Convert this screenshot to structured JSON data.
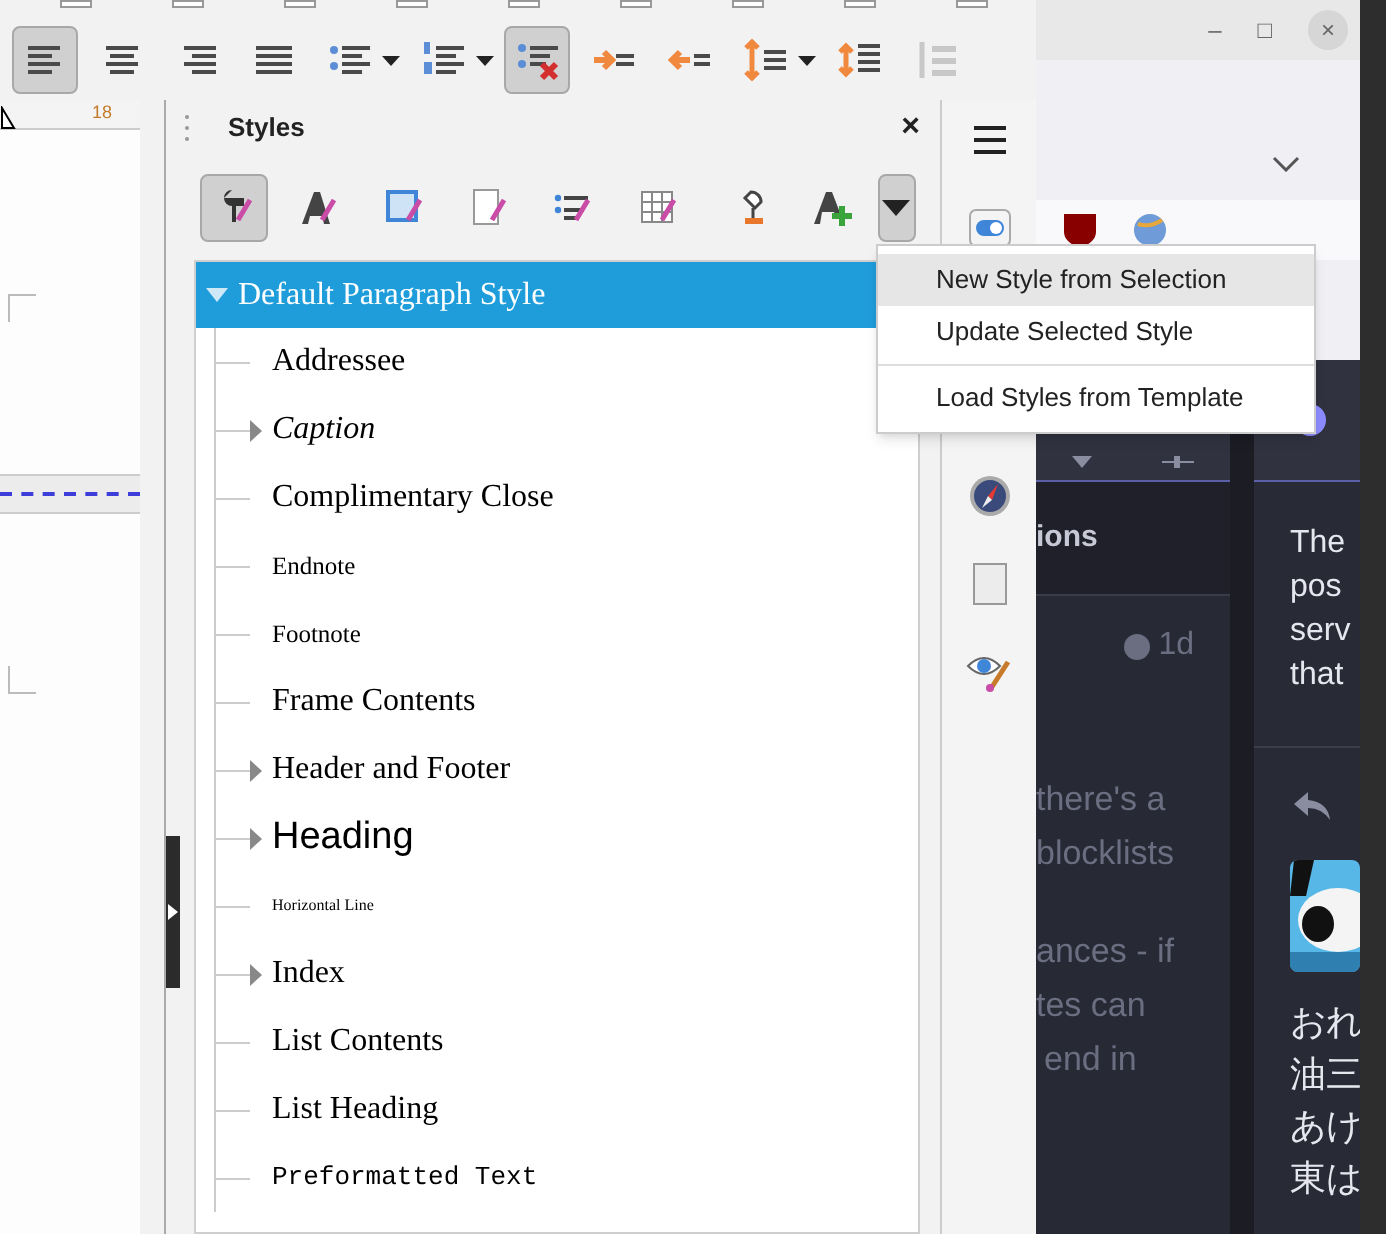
{
  "formatting_toolbar": {
    "buttons": [
      {
        "kind": "align-left",
        "selected": true,
        "dropdown": false
      },
      {
        "kind": "align-center",
        "selected": false,
        "dropdown": false
      },
      {
        "kind": "align-right",
        "selected": false,
        "dropdown": false
      },
      {
        "kind": "justify",
        "selected": false,
        "dropdown": false
      },
      {
        "kind": "bullets",
        "selected": false,
        "dropdown": true
      },
      {
        "kind": "numbering",
        "selected": false,
        "dropdown": true
      },
      {
        "kind": "no-list",
        "selected": true,
        "dropdown": false
      },
      {
        "kind": "indent-increase",
        "selected": false,
        "dropdown": false
      },
      {
        "kind": "indent-decrease",
        "selected": false,
        "dropdown": false
      },
      {
        "kind": "line-spacing",
        "selected": false,
        "dropdown": true
      },
      {
        "kind": "paragraph-spacing",
        "selected": false,
        "dropdown": false
      },
      {
        "kind": "spacing-disabled",
        "selected": false,
        "dropdown": false
      }
    ]
  },
  "ruler": {
    "mark": "18"
  },
  "styles_panel": {
    "title": "Styles",
    "close": "×",
    "toolbar": [
      {
        "kind": "paragraph",
        "selected": true
      },
      {
        "kind": "character",
        "selected": false
      },
      {
        "kind": "frame",
        "selected": false
      },
      {
        "kind": "page",
        "selected": false
      },
      {
        "kind": "list",
        "selected": false
      },
      {
        "kind": "table",
        "selected": false
      }
    ],
    "actions": [
      {
        "kind": "fill-format"
      },
      {
        "kind": "new-style"
      },
      {
        "kind": "menu",
        "selected": true
      }
    ],
    "tree": [
      {
        "label": "Default Paragraph Style",
        "selected": true,
        "expanded": true,
        "children": [
          {
            "label": "Addressee",
            "kind": "plain",
            "selected": false,
            "expandable": false
          },
          {
            "label": "Caption",
            "kind": "italic",
            "selected": false,
            "expandable": true
          },
          {
            "label": "Complimentary Close",
            "kind": "plain",
            "selected": false,
            "expandable": false
          },
          {
            "label": "Endnote",
            "kind": "small",
            "selected": false,
            "expandable": false
          },
          {
            "label": "Footnote",
            "kind": "small",
            "selected": false,
            "expandable": false
          },
          {
            "label": "Frame Contents",
            "kind": "plain",
            "selected": false,
            "expandable": false
          },
          {
            "label": "Header and Footer",
            "kind": "plain",
            "selected": false,
            "expandable": true
          },
          {
            "label": "Heading",
            "kind": "heading",
            "selected": false,
            "expandable": true
          },
          {
            "label": "Horizontal Line",
            "kind": "tiny",
            "selected": false,
            "expandable": false
          },
          {
            "label": "Index",
            "kind": "plain",
            "selected": false,
            "expandable": true
          },
          {
            "label": "List Contents",
            "kind": "plain",
            "selected": false,
            "expandable": false
          },
          {
            "label": "List Heading",
            "kind": "plain",
            "selected": false,
            "expandable": false
          },
          {
            "label": "Preformatted Text",
            "kind": "mono",
            "selected": false,
            "expandable": false
          }
        ]
      }
    ]
  },
  "style_menu": {
    "items": [
      {
        "label": "New Style from Selection",
        "selected": true
      },
      {
        "label": "Update Selected Style",
        "selected": false
      },
      {
        "label": "Load Styles from Template",
        "selected": false
      }
    ]
  },
  "sidebar_tabs": [
    {
      "kind": "menu"
    },
    {
      "kind": "toggle"
    },
    {
      "kind": "compass"
    },
    {
      "kind": "page"
    },
    {
      "kind": "eye"
    }
  ],
  "browser": {
    "window_buttons": [
      "–",
      "□",
      "×"
    ],
    "left_column": {
      "heading": "ions",
      "time": "1d",
      "lines": [
        "there's a",
        "blocklists",
        "ances - if",
        "tes can",
        "end in"
      ]
    },
    "right_column": {
      "lines": [
        "The",
        "pos",
        "serv",
        "that"
      ],
      "japanese": [
        "おれ",
        "油三",
        "あけ",
        "東は"
      ]
    }
  }
}
